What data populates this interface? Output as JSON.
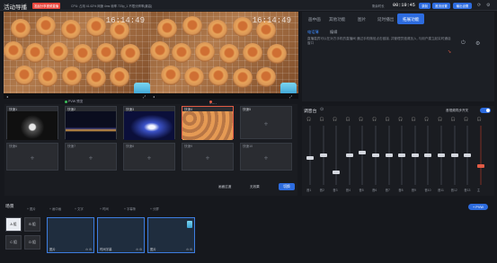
{
  "app": {
    "title": "活动导播",
    "live_badge": "发起分享视频直播",
    "stats": "CPU: 占用 41.62%   网速 4ms   帧率 720p_1   不限分辨率(最高)",
    "clock_label": "剩余时长",
    "clock": "00:19:45",
    "btn_record": "录制",
    "btn_push": "推流设置",
    "btn_output": "输出设置",
    "icons": [
      "refresh-icon",
      "settings-icon"
    ]
  },
  "preview": {
    "left_time": "16:14:49",
    "right_time": "16:14:49",
    "pvw_label": "PVW 预览",
    "pgm_label": "PGM 输出"
  },
  "scenes": {
    "row1": [
      {
        "label": "快速1",
        "thumb": "dark-glass"
      },
      {
        "label": "快速2",
        "thumb": "night-city"
      },
      {
        "label": "快速3",
        "thumb": "blue-screen"
      },
      {
        "label": "快速4",
        "thumb": "cookies"
      },
      {
        "label": "快速5",
        "thumb": ""
      }
    ],
    "row2": [
      {
        "label": "快速6"
      },
      {
        "label": "快速7"
      },
      {
        "label": "快速8"
      },
      {
        "label": "快速9"
      },
      {
        "label": "快速10"
      }
    ],
    "bottom_controls": {
      "transition": "画面过渡",
      "effect": "无效果",
      "go": "切换"
    }
  },
  "right_panel": {
    "tabs": [
      "画中画",
      "其他功能",
      "图片",
      "延时播出",
      "拓展功能"
    ],
    "active_tab": 4,
    "subtabs": [
      "电话薄",
      "编辑"
    ],
    "active_subtab": 0,
    "description": "直播嘉宾可以在对方手机的直播间 通过手机微信点击链接, 并管理员邀请加入, 与用户建立起实时通话窗口"
  },
  "mixer": {
    "title": "调音台",
    "sync_label": "音视频同步开关",
    "channels": [
      {
        "name": "音1",
        "level": 0.45
      },
      {
        "name": "音2",
        "level": 0.5
      },
      {
        "name": "音3",
        "level": 0.2
      },
      {
        "name": "音4",
        "level": 0.5
      },
      {
        "name": "音5",
        "level": 0.55
      },
      {
        "name": "音6",
        "level": 0.5
      },
      {
        "name": "音7",
        "level": 0.5
      },
      {
        "name": "音8",
        "level": 0.5
      },
      {
        "name": "音9",
        "level": 0.5
      },
      {
        "name": "音10",
        "level": 0.5
      },
      {
        "name": "音11",
        "level": 0.5
      },
      {
        "name": "音12",
        "level": 0.5
      },
      {
        "name": "音13",
        "level": 0.5
      },
      {
        "name": "主",
        "level": 0.3
      }
    ]
  },
  "layout": {
    "title": "场景",
    "tools": [
      "图片",
      "画中画",
      "文字",
      "时间",
      "字幕条",
      "分屏"
    ],
    "add_btn": "+ PVW",
    "groups": [
      "A 组",
      "B 组",
      "C 组",
      "D 组"
    ],
    "active_group": 0,
    "cards": [
      {
        "name": "图片"
      },
      {
        "name": "时间字幕"
      },
      {
        "name": "图片"
      }
    ]
  }
}
